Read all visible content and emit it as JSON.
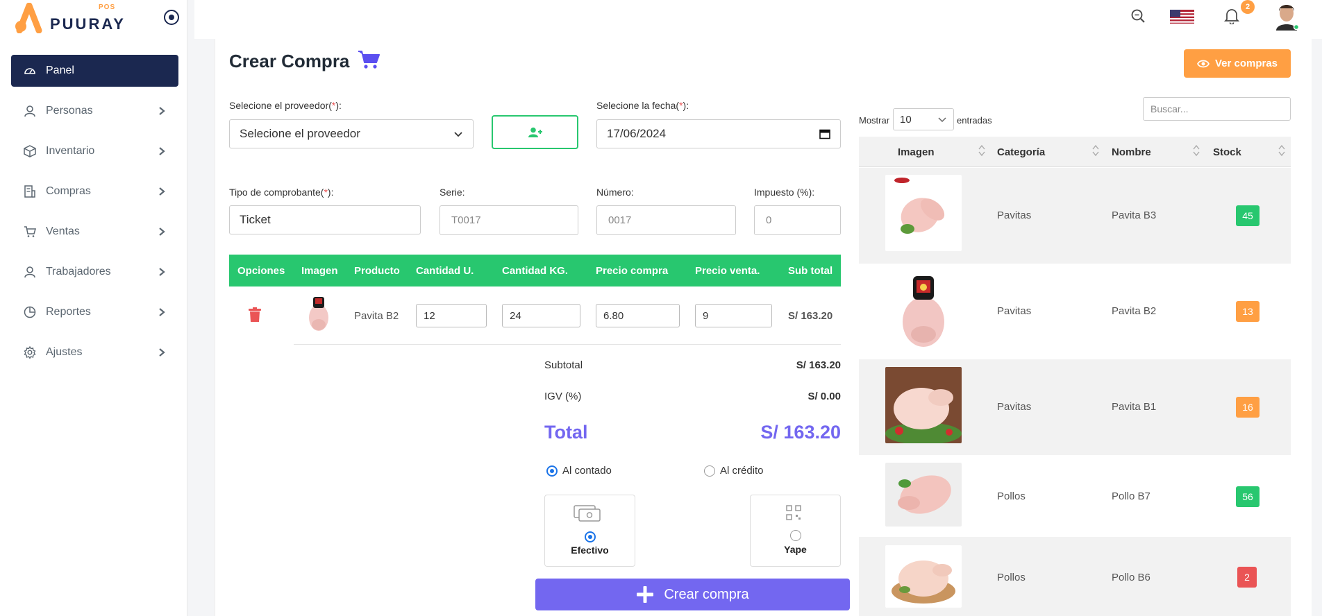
{
  "brand": {
    "name": "PUURAY",
    "sub": "POS"
  },
  "topbar": {
    "notifications": "2"
  },
  "sidebar": {
    "items": [
      {
        "label": "Panel",
        "icon": "dashboard-icon"
      },
      {
        "label": "Personas",
        "icon": "user-icon"
      },
      {
        "label": "Inventario",
        "icon": "box-icon"
      },
      {
        "label": "Compras",
        "icon": "receipt-icon"
      },
      {
        "label": "Ventas",
        "icon": "cart-icon"
      },
      {
        "label": "Trabajadores",
        "icon": "user-icon"
      },
      {
        "label": "Reportes",
        "icon": "pie-icon"
      },
      {
        "label": "Ajustes",
        "icon": "gear-icon"
      }
    ]
  },
  "page": {
    "title": "Crear Compra",
    "ver_compras": "Ver compras"
  },
  "form": {
    "proveedor_label": "Selecione el proveedor(",
    "req": "*",
    "close": "):",
    "proveedor_value": "Selecione el proveedor",
    "fecha_label": "Selecione la fecha(",
    "fecha_value": "17/06/2024",
    "tipo_label": "Tipo de comprobante(",
    "tipo_value": "Ticket",
    "serie_label": "Serie:",
    "serie_placeholder": "T0017",
    "numero_label": "Número:",
    "numero_placeholder": "0017",
    "impuesto_label": "Impuesto (%):",
    "impuesto_placeholder": "0"
  },
  "detail_table": {
    "headers": [
      "Opciones",
      "Imagen",
      "Producto",
      "Cantidad U.",
      "Cantidad KG.",
      "Precio compra",
      "Precio venta.",
      "Sub total"
    ],
    "row": {
      "producto": "Pavita B2",
      "cantidad_u": "12",
      "cantidad_kg": "24",
      "precio_compra": "6.80",
      "precio_venta": "9",
      "subtotal": "S/ 163.20"
    }
  },
  "summary": {
    "subtotal_label": "Subtotal",
    "subtotal_value": "S/ 163.20",
    "igv_label": "IGV (%)",
    "igv_value": "S/ 0.00",
    "total_label": "Total",
    "total_value": "S/ 163.20"
  },
  "payment": {
    "contado": "Al contado",
    "credito": "Al crédito",
    "efectivo": "Efectivo",
    "yape": "Yape",
    "selected_term": "Al contado",
    "selected_method": "Efectivo"
  },
  "crear_button": "Crear compra",
  "products": {
    "show_label": "Mostrar",
    "show_value": "10",
    "entries_label": "entradas",
    "search_placeholder": "Buscar...",
    "headers": [
      "Imagen",
      "Categoría",
      "Nombre",
      "Stock"
    ],
    "rows": [
      {
        "categoria": "Pavitas",
        "nombre": "Pavita B3",
        "stock": "45",
        "stock_color": "#28c76f"
      },
      {
        "categoria": "Pavitas",
        "nombre": "Pavita B2",
        "stock": "13",
        "stock_color": "#ff9f43"
      },
      {
        "categoria": "Pavitas",
        "nombre": "Pavita B1",
        "stock": "16",
        "stock_color": "#ff9f43"
      },
      {
        "categoria": "Pollos",
        "nombre": "Pollo B7",
        "stock": "56",
        "stock_color": "#28c76f"
      },
      {
        "categoria": "Pollos",
        "nombre": "Pollo B6",
        "stock": "2",
        "stock_color": "#ea5455"
      }
    ]
  },
  "colors": {
    "navy": "#1b2850",
    "orange": "#ff9f43",
    "green": "#28c76f",
    "purple": "#7367f0",
    "red": "#ea5455"
  }
}
